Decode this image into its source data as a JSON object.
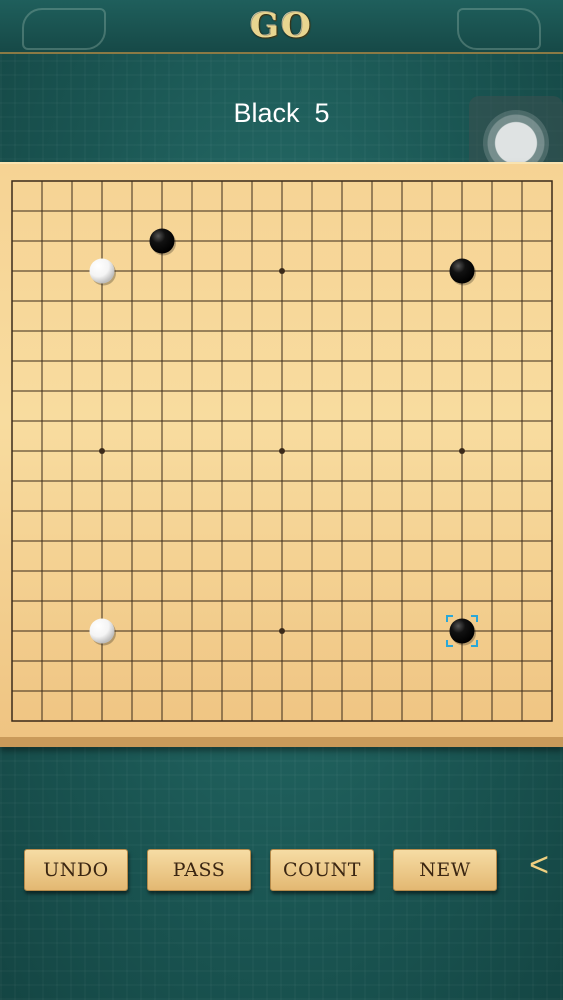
{
  "header": {
    "title": "GO"
  },
  "status": {
    "player": "Black",
    "move_number": "5"
  },
  "floating_button": {
    "icon": "assistive-touch-icon"
  },
  "board": {
    "size": 19,
    "star_points": [
      [
        3,
        3
      ],
      [
        3,
        9
      ],
      [
        3,
        15
      ],
      [
        9,
        3
      ],
      [
        9,
        9
      ],
      [
        9,
        15
      ],
      [
        15,
        3
      ],
      [
        15,
        9
      ],
      [
        15,
        15
      ]
    ],
    "stones": [
      {
        "color": "black",
        "col": 5,
        "row": 2
      },
      {
        "color": "white",
        "col": 3,
        "row": 3
      },
      {
        "color": "black",
        "col": 15,
        "row": 3
      },
      {
        "color": "white",
        "col": 3,
        "row": 15
      },
      {
        "color": "black",
        "col": 15,
        "row": 15
      }
    ],
    "last_move": {
      "col": 15,
      "row": 15
    },
    "colors": {
      "line": "#3a2a1a",
      "black_stone": "#111111",
      "white_stone": "#f4f4f4",
      "marker": "#2aa7d8"
    }
  },
  "buttons": {
    "undo": "UNDO",
    "pass": "PASS",
    "count": "COUNT",
    "new": "NEW"
  },
  "nav": {
    "back_glyph": "<",
    "icon": "chevron-left-icon"
  }
}
